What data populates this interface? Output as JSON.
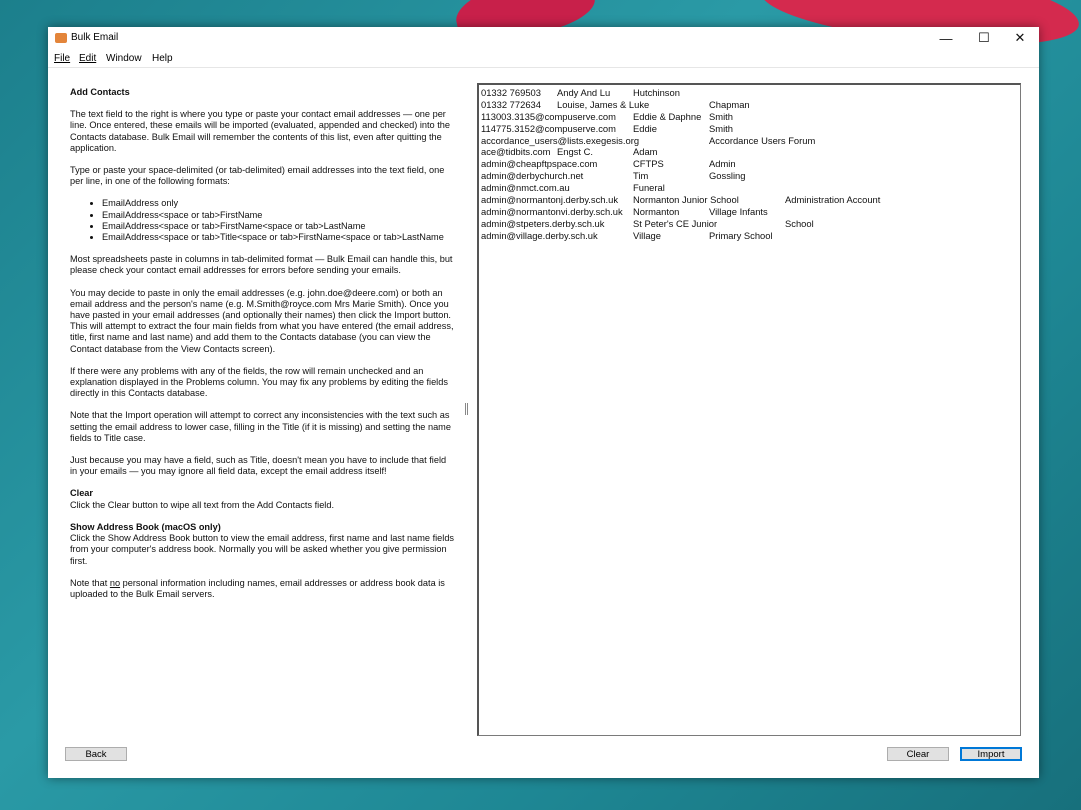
{
  "window": {
    "title": "Bulk Email",
    "controls": {
      "minimize": "—",
      "maximize": "☐",
      "close": "✕"
    }
  },
  "menu": [
    {
      "label": "File"
    },
    {
      "label": "Edit"
    },
    {
      "label": "Window"
    },
    {
      "label": "Help"
    }
  ],
  "help": {
    "heading": "Add Contacts",
    "p1": "The text field to the right is where you type or paste your contact email addresses — one per line. Once entered, these emails will be imported (evaluated, appended and checked) into the Contacts database. Bulk Email will remember the contents of this list, even after quitting the application.",
    "p2": "Type or paste your space-delimited (or tab-delimited) email addresses into the text field, one per line, in one of the following formats:",
    "formats": [
      "EmailAddress only",
      "EmailAddress<space or tab>FirstName",
      "EmailAddress<space or tab>FirstName<space or tab>LastName",
      "EmailAddress<space or tab>Title<space or tab>FirstName<space or tab>LastName"
    ],
    "p3": "Most spreadsheets paste in columns in tab-delimited format — Bulk Email can handle this, but please check your contact email addresses for errors before sending your emails.",
    "p4": "You may decide to paste in only the email addresses (e.g. john.doe@deere.com) or both an email address and the person's name (e.g. M.Smith@royce.com Mrs Marie Smith). Once you have pasted in your email addresses (and optionally their names) then click the Import button. This will attempt to extract the four main fields from what you have entered (the email address, title, first name and last name) and add them to the Contacts database (you can view the Contact database from the View Contacts screen).",
    "p5": "If there were any problems with any of the fields, the row will remain unchecked and an explanation displayed in the Problems column. You may fix any problems by editing the fields directly in this Contacts database.",
    "p6": "Note that the Import operation will attempt to correct any inconsistencies with the text such as setting the email address to lower case, filling in the Title (if it is missing) and setting the name fields to Title case.",
    "p7": "Just because you may have a field, such as Title, doesn't mean you have to include that field in your emails — you may ignore all field data, except the email address itself!",
    "clear_heading": "Clear",
    "clear_text": "Click the Clear button to wipe all text from the Add Contacts field.",
    "addressbook_heading": "Show Address Book (macOS only)",
    "addressbook_text": "Click the Show Address Book button to view the email address, first name and last name fields from your computer's address book. Normally you will be asked whether you give permission first.",
    "privacy_pre": "Note that ",
    "privacy_no": "no",
    "privacy_post": " personal information including names, email addresses or address book data is uploaded to the Bulk Email servers."
  },
  "contacts": [
    {
      "c1": "01332 769503",
      "c2": "Andy And Lu",
      "c3": "Hutchinson",
      "c4": ""
    },
    {
      "c1": "01332 772634",
      "c2": "Louise, James & Luke",
      "c3": "Chapman",
      "c4": ""
    },
    {
      "c1": "113003.3135@compuserve.com",
      "c2": "Eddie & Daphne",
      "c3": "Smith",
      "c4": ""
    },
    {
      "c1": "114775.3152@compuserve.com",
      "c2": "Eddie",
      "c3": "Smith",
      "c4": ""
    },
    {
      "c1": "accordance_users@lists.exegesis.org",
      "c2": "Accordance Users Forum",
      "c3": "",
      "c4": ""
    },
    {
      "c1": "ace@tidbits.com",
      "c2": "Engst C.",
      "c3": "Adam",
      "c4": ""
    },
    {
      "c1": "admin@cheapftpspace.com",
      "c2": "CFTPS",
      "c3": "Admin",
      "c4": ""
    },
    {
      "c1": "admin@derbychurch.net",
      "c2": "Tim",
      "c3": "Gossling",
      "c4": ""
    },
    {
      "c1": "admin@nmct.com.au",
      "c2": "Funeral",
      "c3": "",
      "c4": ""
    },
    {
      "c1": "admin@normantonj.derby.sch.uk",
      "c2": "Normanton Junior School",
      "c3": "Administration Account",
      "c4": ""
    },
    {
      "c1": "admin@normantonvi.derby.sch.uk",
      "c2": "Normanton",
      "c3": "Village Infants",
      "c4": ""
    },
    {
      "c1": "admin@stpeters.derby.sch.uk",
      "c2": "St Peter's CE Junior",
      "c3": "School",
      "c4": ""
    },
    {
      "c1": "admin@village.derby.sch.uk",
      "c2": "Village",
      "c3": "Primary School",
      "c4": ""
    }
  ],
  "buttons": {
    "back": "Back",
    "clear": "Clear",
    "import": "Import"
  }
}
